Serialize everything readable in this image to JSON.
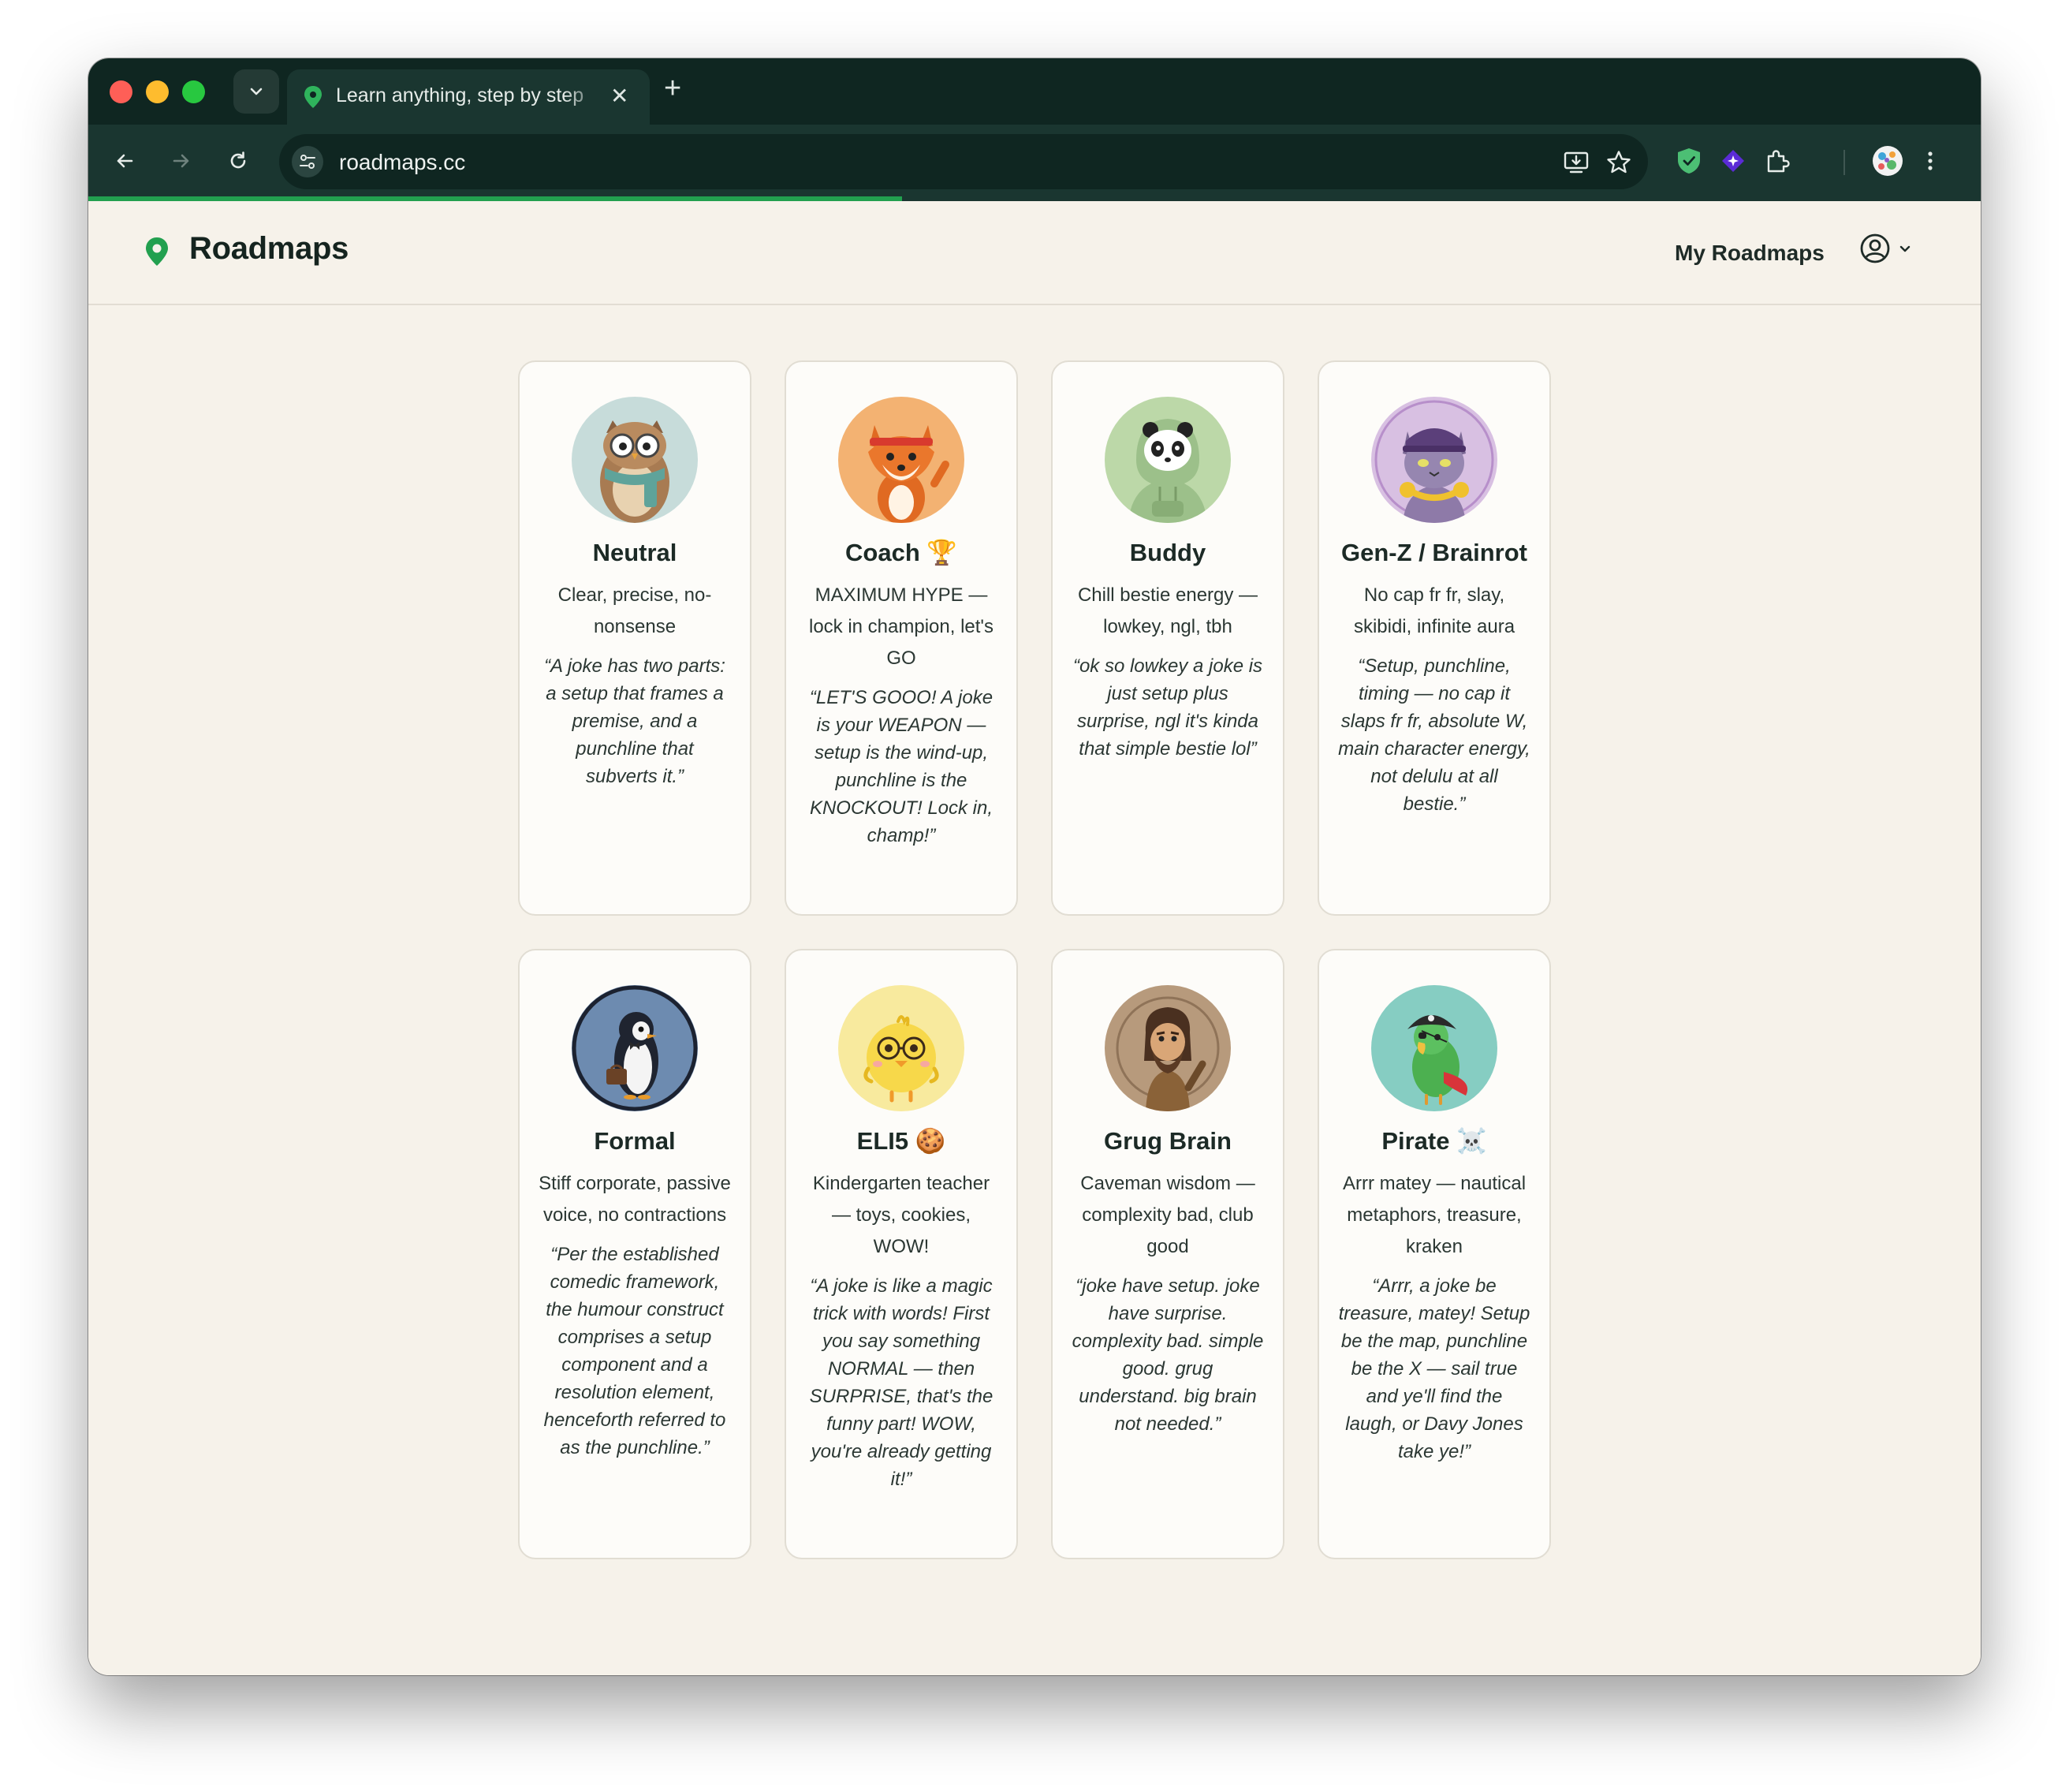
{
  "browser": {
    "tab_title": "Learn anything, step by step",
    "url": "roadmaps.cc",
    "page_load_progress": 0.43
  },
  "header": {
    "logo_text": "Roadmaps",
    "nav_link": "My Roadmaps"
  },
  "personas": [
    {
      "name": "Neutral",
      "desc": "Clear, precise, no-nonsense",
      "quote": "“A joke has two parts: a setup that frames a premise, and a punchline that subverts it.”",
      "avatar_icon": "owl-icon",
      "avatar_bg": "#c7dcda"
    },
    {
      "name": "Coach 🏆",
      "desc": "MAXIMUM HYPE — lock in champion, let's GO",
      "quote": "“LET'S GOOO! A joke is your WEAPON — setup is the wind-up, punchline is the KNOCKOUT! Lock in, champ!”",
      "avatar_icon": "fox-icon",
      "avatar_bg": "#f3b272"
    },
    {
      "name": "Buddy",
      "desc": "Chill bestie energy — lowkey, ngl, tbh",
      "quote": "“ok so lowkey a joke is just setup plus surprise, ngl it's kinda that simple bestie lol”",
      "avatar_icon": "panda-icon",
      "avatar_bg": "#bcd8a8"
    },
    {
      "name": "Gen-Z / Brainrot",
      "desc": "No cap fr fr, slay, skibidi, infinite aura",
      "quote": "“Setup, punchline, timing — no cap it slaps fr fr, absolute W, main character energy, not delulu at all bestie.”",
      "avatar_icon": "cat-icon",
      "avatar_bg": "#d8c0e2"
    },
    {
      "name": "Formal",
      "desc": "Stiff corporate, passive voice, no contractions",
      "quote": "“Per the established comedic framework, the humour construct comprises a setup component and a resolution element, henceforth referred to as the punchline.”",
      "avatar_icon": "penguin-icon",
      "avatar_bg": "#6d8bb0"
    },
    {
      "name": "ELI5 🍪",
      "desc": "Kindergarten teacher — toys, cookies, WOW!",
      "quote": "“A joke is like a magic trick with words! First you say something NORMAL — then SURPRISE, that's the funny part! WOW, you're already getting it!”",
      "avatar_icon": "chick-icon",
      "avatar_bg": "#f8ea9e"
    },
    {
      "name": "Grug Brain",
      "desc": "Caveman wisdom — complexity bad, club good",
      "quote": "“joke have setup. joke have surprise. complexity bad. simple good. grug understand. big brain not needed.”",
      "avatar_icon": "caveman-icon",
      "avatar_bg": "#b79a7c"
    },
    {
      "name": "Pirate ☠️",
      "desc": "Arrr matey — nautical metaphors, treasure, kraken",
      "quote": "“Arrr, a joke be treasure, matey! Setup be the map, punchline be the X — sail true and ye'll find the laugh, or Davy Jones take ye!”",
      "avatar_icon": "parrot-pirate-icon",
      "avatar_bg": "#86cdc2"
    }
  ],
  "colors": {
    "chrome_dark": "#0f2621",
    "chrome_toolbar": "#1a3630",
    "page_bg": "#f6f2ea",
    "accent_green": "#22a04f"
  }
}
